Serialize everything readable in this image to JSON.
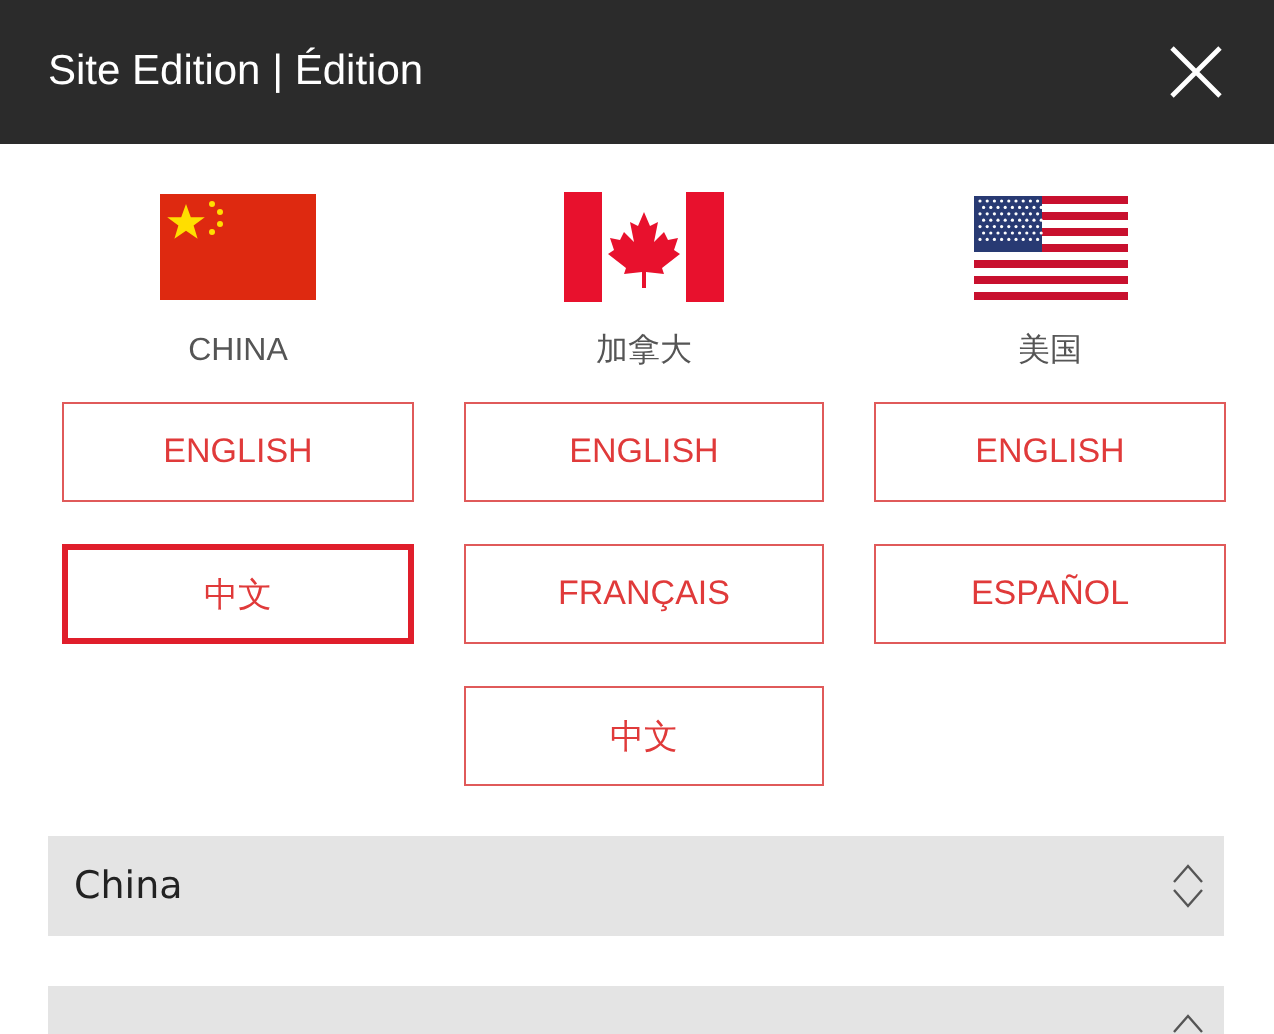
{
  "header": {
    "title": "Site Edition | Édition"
  },
  "countries": [
    {
      "kind": "china",
      "label": "CHINA",
      "languages": [
        {
          "label": "ENGLISH",
          "selected": false
        },
        {
          "label": "中文",
          "selected": true
        }
      ]
    },
    {
      "kind": "canada",
      "label": "加拿大",
      "languages": [
        {
          "label": "ENGLISH",
          "selected": false
        },
        {
          "label": "FRANÇAIS",
          "selected": false
        },
        {
          "label": "中文",
          "selected": false
        }
      ]
    },
    {
      "kind": "usa",
      "label": "美国",
      "languages": [
        {
          "label": "ENGLISH",
          "selected": false
        },
        {
          "label": "ESPAÑOL",
          "selected": false
        }
      ]
    }
  ],
  "selects": [
    {
      "kind": "full",
      "value": "China"
    },
    {
      "kind": "cut"
    }
  ]
}
